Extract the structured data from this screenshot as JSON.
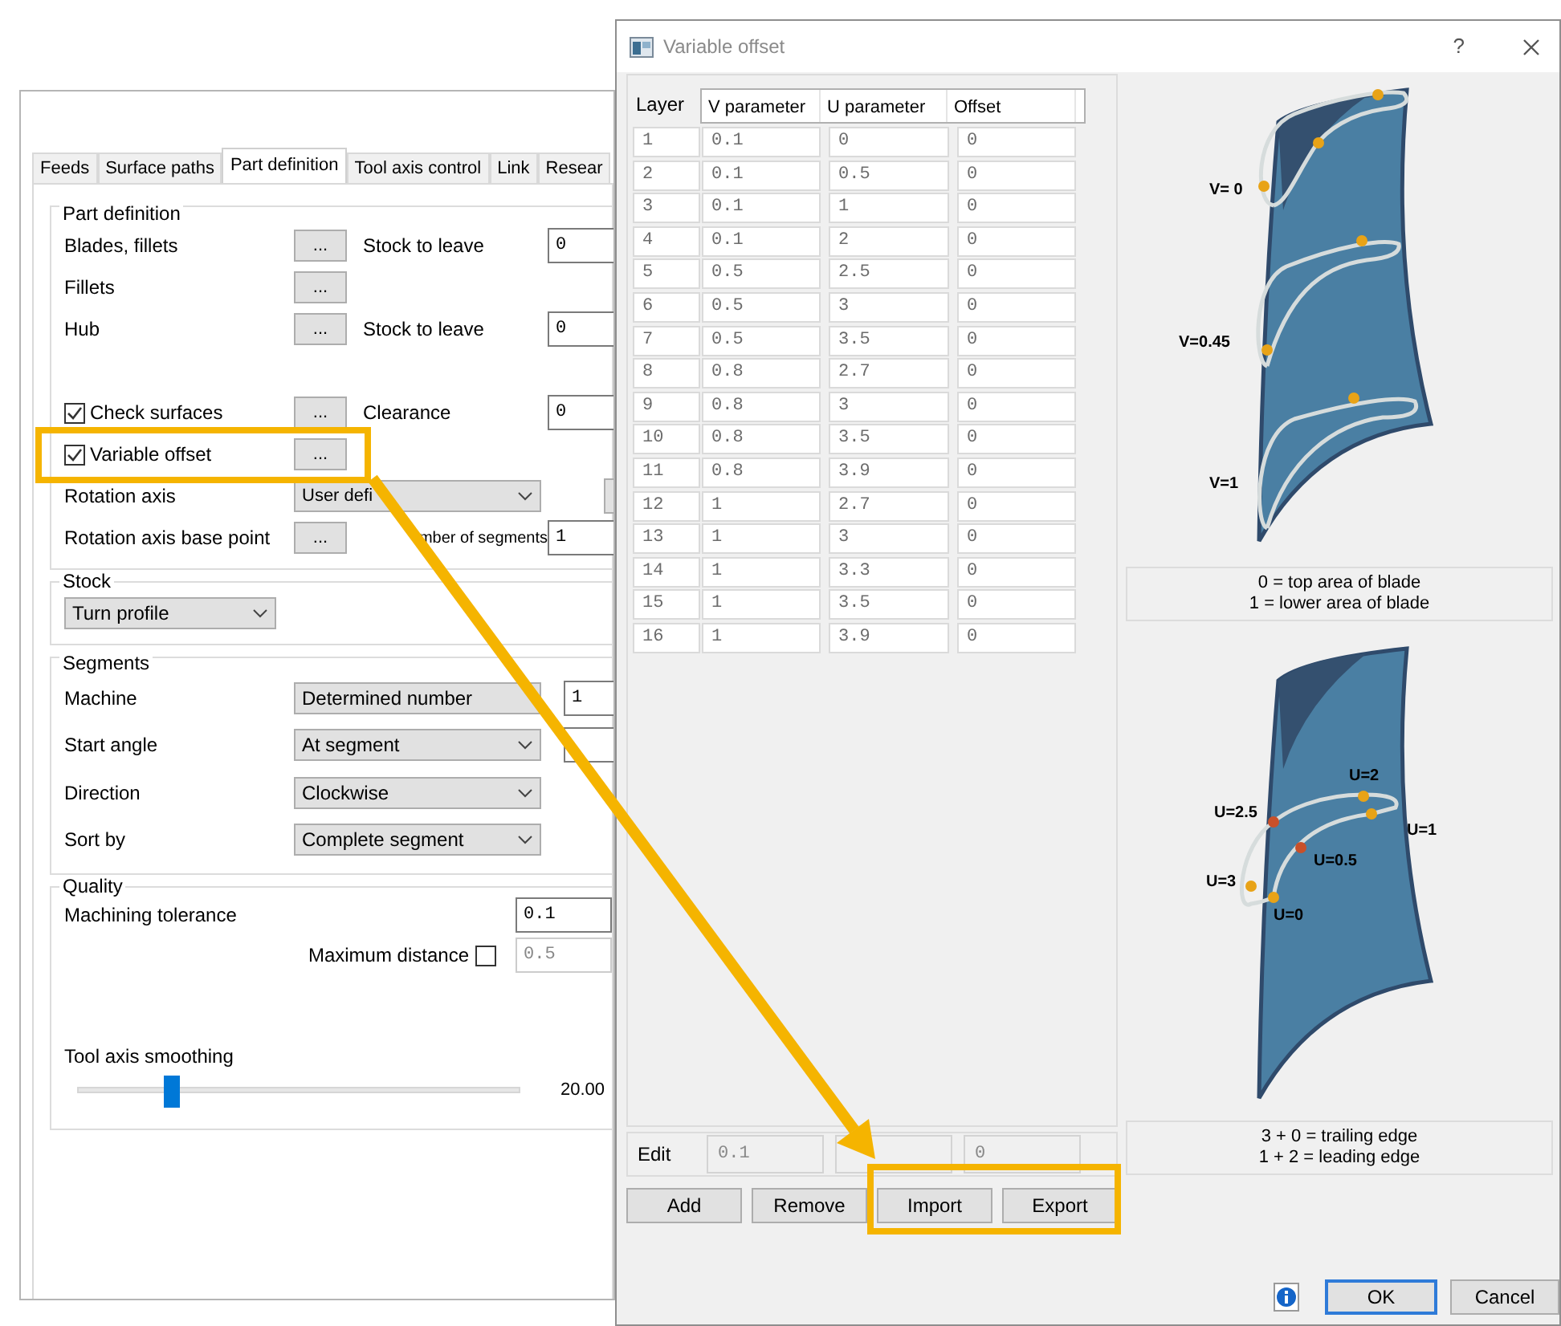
{
  "settings_window": {
    "tabs": [
      {
        "label": "Feeds",
        "selected": false
      },
      {
        "label": "Surface paths",
        "selected": false
      },
      {
        "label": "Part definition",
        "selected": true
      },
      {
        "label": "Tool axis control",
        "selected": false
      },
      {
        "label": "Link",
        "selected": false
      },
      {
        "label": "Resear",
        "selected": false
      }
    ],
    "part_definition": {
      "title": "Part definition",
      "rows": [
        {
          "kind": "pick",
          "label": "Blades, fillets",
          "button": "...",
          "side_label": "Stock to leave",
          "value": "0"
        },
        {
          "kind": "pick",
          "label": "Fillets",
          "button": "..."
        },
        {
          "kind": "pick",
          "label": "Hub",
          "button": "...",
          "side_label": "Stock to leave",
          "value": "0"
        },
        {
          "kind": "spacer"
        },
        {
          "kind": "check",
          "label": "Check surfaces",
          "checked": true,
          "button": "...",
          "side_label": "Clearance",
          "value": "0"
        },
        {
          "kind": "check",
          "label": "Variable offset",
          "checked": true,
          "button": "..."
        },
        {
          "kind": "combo",
          "label": "Rotation axis",
          "selection": "User defi",
          "extra_button": true
        },
        {
          "kind": "pick_far",
          "label": "Rotation axis base point",
          "button": "...",
          "side_label": "mber of segments",
          "value": "1"
        }
      ]
    },
    "stock": {
      "title": "Stock",
      "selection": "Turn profile"
    },
    "segments": {
      "title": "Segments",
      "rows": [
        {
          "label": "Machine",
          "selection": "Determined number",
          "caret": false,
          "value": "1"
        },
        {
          "label": "Start angle",
          "selection": "At segment",
          "caret": true,
          "field": true
        },
        {
          "label": "Direction",
          "selection": "Clockwise",
          "caret": true
        },
        {
          "label": "Sort by",
          "selection": "Complete segment",
          "caret": true
        }
      ]
    },
    "quality": {
      "title": "Quality",
      "tolerance_label": "Machining tolerance",
      "tolerance": "0.1",
      "max_distance_label": "Maximum distance",
      "max_distance_checked": false,
      "max_distance": "0.5",
      "max_distance_disabled": true,
      "smoothing_label": "Tool axis smoothing",
      "smoothing": {
        "level": 0.21,
        "reading": "20.00"
      }
    }
  },
  "dialog": {
    "title": "Variable offset",
    "help": "?",
    "table": {
      "columns": [
        "Layer",
        "V parameter",
        "U parameter",
        "Offset"
      ],
      "rows": [
        [
          "1",
          "0.1",
          "0",
          "0"
        ],
        [
          "2",
          "0.1",
          "0.5",
          "0"
        ],
        [
          "3",
          "0.1",
          "1",
          "0"
        ],
        [
          "4",
          "0.1",
          "2",
          "0"
        ],
        [
          "5",
          "0.5",
          "2.5",
          "0"
        ],
        [
          "6",
          "0.5",
          "3",
          "0"
        ],
        [
          "7",
          "0.5",
          "3.5",
          "0"
        ],
        [
          "8",
          "0.8",
          "2.7",
          "0"
        ],
        [
          "9",
          "0.8",
          "3",
          "0"
        ],
        [
          "10",
          "0.8",
          "3.5",
          "0"
        ],
        [
          "11",
          "0.8",
          "3.9",
          "0"
        ],
        [
          "12",
          "1",
          "2.7",
          "0"
        ],
        [
          "13",
          "1",
          "3",
          "0"
        ],
        [
          "14",
          "1",
          "3.3",
          "0"
        ],
        [
          "15",
          "1",
          "3.5",
          "0"
        ],
        [
          "16",
          "1",
          "3.9",
          "0"
        ]
      ]
    },
    "edit": {
      "label": "Edit",
      "v_value": "0.1",
      "offset_value": "0"
    },
    "buttons": [
      "Add",
      "Remove",
      "Import",
      "Export"
    ],
    "v_diagram": {
      "labels": [
        "V= 0",
        "V=0.45",
        "V=1"
      ],
      "caption": [
        "0 = top area of blade",
        "1 = lower area of blade"
      ]
    },
    "u_diagram": {
      "labels": [
        "U=2",
        "U=2.5",
        "U=1",
        "U=0.5",
        "U=3",
        "U=0"
      ],
      "caption": [
        "3 + 0 = trailing edge",
        "1 + 2 = leading edge"
      ]
    },
    "footer": {
      "ok": "OK",
      "cancel": "Cancel"
    }
  }
}
